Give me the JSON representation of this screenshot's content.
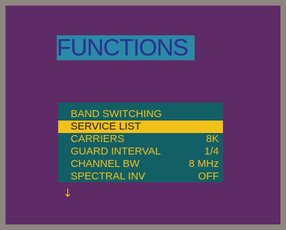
{
  "title": "FUNCTIONS",
  "menu": {
    "items": [
      {
        "label": "BAND SWITCHING",
        "value": "",
        "selected": false
      },
      {
        "label": "SERVICE LIST",
        "value": "",
        "selected": true
      },
      {
        "label": "CARRIERS",
        "value": "8K",
        "selected": false
      },
      {
        "label": "GUARD INTERVAL",
        "value": "1/4",
        "selected": false
      },
      {
        "label": "CHANNEL BW",
        "value": "8 MHz",
        "selected": false
      },
      {
        "label": "SPECTRAL INV",
        "value": "OFF",
        "selected": false
      }
    ]
  },
  "scroll_indicator": {
    "icon": "arrow-down-icon"
  },
  "colors": {
    "background": "#5e2b66",
    "title_bg": "#2b8aa6",
    "title_text": "#2a2f94",
    "menu_bg": "#135f66",
    "menu_text": "#f2c11a",
    "selection_bg": "#f2c11a",
    "selection_text": "#1a1a1a"
  }
}
